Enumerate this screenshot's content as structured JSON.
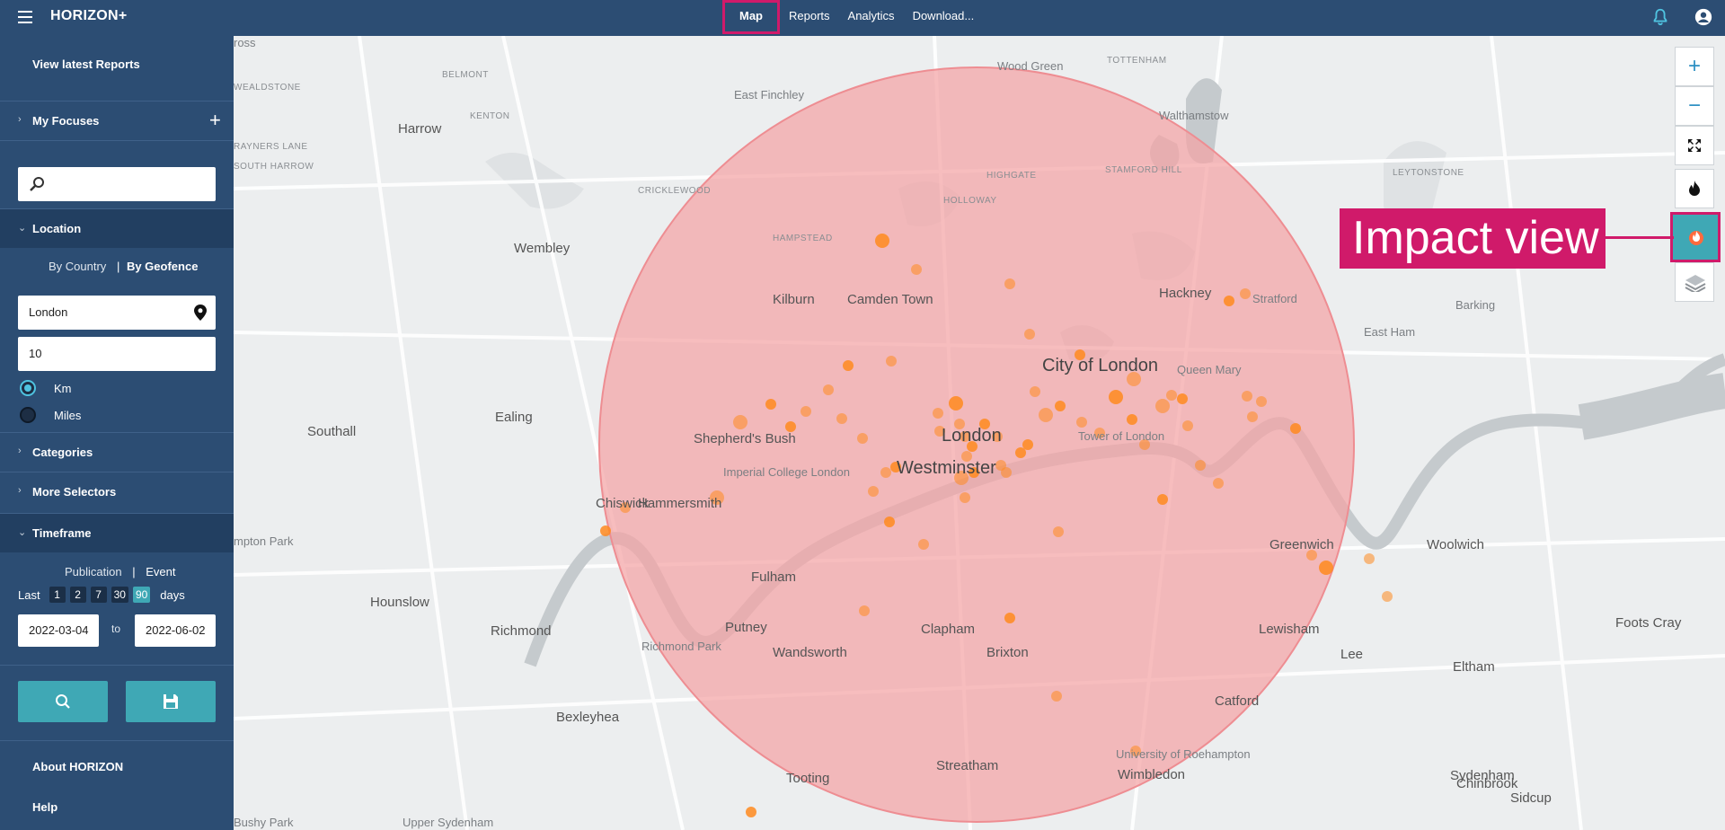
{
  "app": {
    "title": "HORIZON+"
  },
  "nav": [
    {
      "label": "Map",
      "active": true
    },
    {
      "label": "Reports"
    },
    {
      "label": "Analytics"
    },
    {
      "label": "Download..."
    }
  ],
  "sidebar": {
    "latest_reports": "View latest Reports",
    "my_focuses": "My Focuses",
    "search_value": "",
    "location": {
      "label": "Location",
      "by_country": "By Country",
      "separator": "|",
      "by_geofence": "By Geofence",
      "place_value": "London",
      "radius_value": "10",
      "units": [
        {
          "label": "Km",
          "selected": true
        },
        {
          "label": "Miles",
          "selected": false
        }
      ]
    },
    "categories": "Categories",
    "more_selectors": "More Selectors",
    "timeframe": {
      "label": "Timeframe",
      "publication": "Publication",
      "separator": "|",
      "event": "Event",
      "last": "Last",
      "days_options": [
        "1",
        "2",
        "7",
        "30",
        "90"
      ],
      "selected_days": "90",
      "days": "days",
      "from": "2022-03-04",
      "to_label": "to",
      "to": "2022-06-02"
    },
    "about": "About HORIZON",
    "help": "Help"
  },
  "map": {
    "controls": {
      "zoom_in": "+",
      "zoom_out": "−"
    },
    "callout": "Impact view",
    "circle_color": "#f4a3a5",
    "marker_color": "#ff8a1f",
    "places": [
      {
        "name": "BELMONT",
        "cls": "small"
      },
      {
        "name": "Wood Green",
        "cls": ""
      },
      {
        "name": "TOTTENHAM",
        "cls": "small"
      },
      {
        "name": "WEALDSTONE",
        "cls": "small"
      },
      {
        "name": "East Finchley",
        "cls": ""
      },
      {
        "name": "Harrow",
        "cls": "big"
      },
      {
        "name": "Walthamstow",
        "cls": ""
      },
      {
        "name": "KENTON",
        "cls": "small"
      },
      {
        "name": "RAYNERS LANE",
        "cls": "small"
      },
      {
        "name": "CRICKLEWOOD",
        "cls": "small"
      },
      {
        "name": "HIGHGATE",
        "cls": "small"
      },
      {
        "name": "STAMFORD HILL",
        "cls": "small"
      },
      {
        "name": "LEYTONSTONE",
        "cls": "small"
      },
      {
        "name": "SOUTH HARROW",
        "cls": "small"
      },
      {
        "name": "HAMPSTEAD",
        "cls": "small"
      },
      {
        "name": "HOLLOWAY",
        "cls": "small"
      },
      {
        "name": "Wembley",
        "cls": "big"
      },
      {
        "name": "Kilburn",
        "cls": "big"
      },
      {
        "name": "Camden Town",
        "cls": "big"
      },
      {
        "name": "Hackney",
        "cls": "big"
      },
      {
        "name": "Stratford",
        "cls": ""
      },
      {
        "name": "Barking",
        "cls": ""
      },
      {
        "name": "East Ham",
        "cls": ""
      },
      {
        "name": "City of London",
        "cls": "huge"
      },
      {
        "name": "Queen Mary",
        "cls": ""
      },
      {
        "name": "Ealing",
        "cls": "big"
      },
      {
        "name": "Southall",
        "cls": "big"
      },
      {
        "name": "Shepherd's Bush",
        "cls": "big"
      },
      {
        "name": "London",
        "cls": "huge"
      },
      {
        "name": "Westminster",
        "cls": "huge"
      },
      {
        "name": "Imperial College London",
        "cls": ""
      },
      {
        "name": "Tower of London",
        "cls": ""
      },
      {
        "name": "Chiswick",
        "cls": "big"
      },
      {
        "name": "Hammersmith",
        "cls": "big"
      },
      {
        "name": "Fulham",
        "cls": "big"
      },
      {
        "name": "Greenwich",
        "cls": "big"
      },
      {
        "name": "Woolwich",
        "cls": "big"
      },
      {
        "name": "Hounslow",
        "cls": "big"
      },
      {
        "name": "Richmond",
        "cls": "big"
      },
      {
        "name": "Putney",
        "cls": "big"
      },
      {
        "name": "Wandsworth",
        "cls": "big"
      },
      {
        "name": "Clapham",
        "cls": "big"
      },
      {
        "name": "Brixton",
        "cls": "big"
      },
      {
        "name": "Lewisham",
        "cls": "big"
      },
      {
        "name": "Lee",
        "cls": "big"
      },
      {
        "name": "Eltham",
        "cls": "big"
      },
      {
        "name": "Catford",
        "cls": "big"
      },
      {
        "name": "Streatham",
        "cls": "big"
      },
      {
        "name": "Tooting",
        "cls": "big"
      },
      {
        "name": "Wimbledon",
        "cls": "big"
      },
      {
        "name": "Sydenham",
        "cls": "big"
      },
      {
        "name": "Chinbrook",
        "cls": "big"
      },
      {
        "name": "Sidcup",
        "cls": "big"
      },
      {
        "name": "Foots Cray",
        "cls": "big"
      },
      {
        "name": "Bexleyhea",
        "cls": "big"
      },
      {
        "name": "Richmond Park",
        "cls": ""
      },
      {
        "name": "University of Roehampton",
        "cls": ""
      },
      {
        "name": "Upper Sydenham",
        "cls": ""
      },
      {
        "name": "Bushy Park",
        "cls": ""
      },
      {
        "name": "mpton Park",
        "cls": ""
      },
      {
        "name": "ross",
        "cls": ""
      }
    ]
  }
}
